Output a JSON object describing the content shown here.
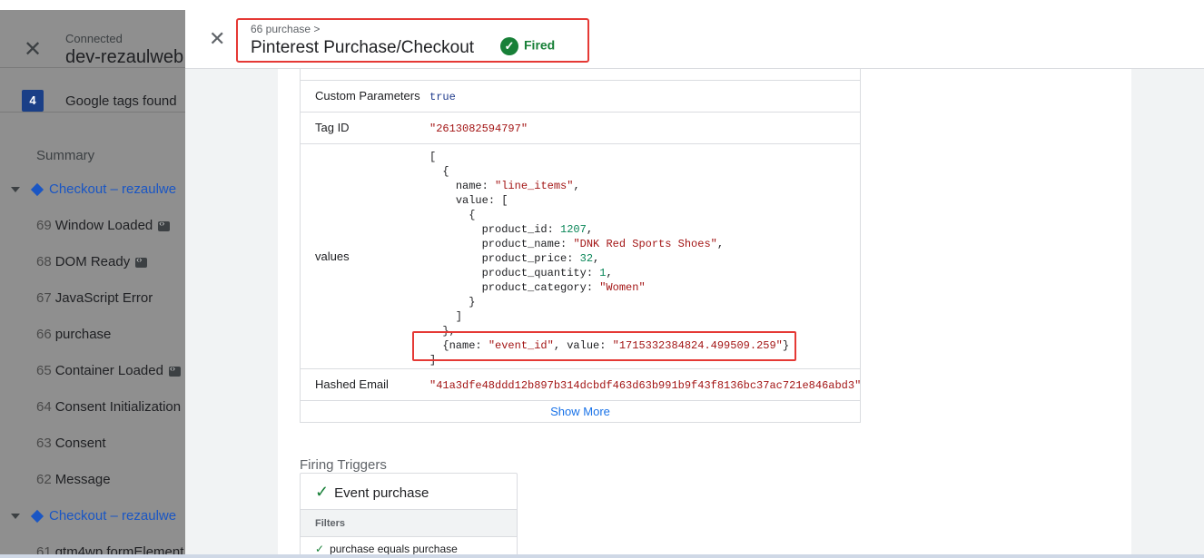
{
  "sidebar": {
    "status": "Connected",
    "host": "dev-rezaulweb",
    "tags_count": "4",
    "tags_found_label": "Google tags found",
    "summary_label": "Summary",
    "groups": [
      {
        "label": "Checkout – rezaulwe"
      },
      {
        "label": "Checkout – rezaulwe"
      }
    ],
    "events": [
      {
        "num": "69",
        "label": "Window Loaded"
      },
      {
        "num": "68",
        "label": "DOM Ready"
      },
      {
        "num": "67",
        "label": "JavaScript Error"
      },
      {
        "num": "66",
        "label": "purchase"
      },
      {
        "num": "65",
        "label": "Container Loaded"
      },
      {
        "num": "64",
        "label": "Consent Initialization"
      },
      {
        "num": "63",
        "label": "Consent"
      },
      {
        "num": "62",
        "label": "Message"
      },
      {
        "num": "61",
        "label": "gtm4wp.formElement"
      }
    ]
  },
  "header": {
    "breadcrumb": "66 purchase >",
    "title": "Pinterest Purchase/Checkout",
    "status": "Fired"
  },
  "properties": {
    "custom_params_key": "Custom Parameters",
    "custom_params_val": "true",
    "tag_id_key": "Tag ID",
    "tag_id_val": "\"2613082594797\"",
    "values_key": "values",
    "hashed_email_key": "Hashed Email",
    "hashed_email_val": "\"41a3dfe48ddd12b897b314dcbdf463d63b991b9f43f8136bc37ac721e846abd3\"",
    "show_more": "Show More"
  },
  "values_code": {
    "name1_key": "name",
    "name1_val": "\"line_items\"",
    "value_key": "value",
    "product_id_key": "product_id",
    "product_id_val": "1207",
    "product_name_key": "product_name",
    "product_name_val": "\"DNK Red Sports Shoes\"",
    "product_price_key": "product_price",
    "product_price_val": "32",
    "product_quantity_key": "product_quantity",
    "product_quantity_val": "1",
    "product_category_key": "product_category",
    "product_category_val": "\"Women\"",
    "event_name_val": "\"event_id\"",
    "event_value_val": "\"1715332384824.499509.259\""
  },
  "firing_triggers": {
    "title": "Firing Triggers",
    "trigger_name": "Event purchase",
    "filters_label": "Filters",
    "condition": "purchase   equals   purchase"
  },
  "colors": {
    "fired_green": "#188038",
    "highlight_red": "#e53935",
    "link_blue": "#1a73e8"
  }
}
